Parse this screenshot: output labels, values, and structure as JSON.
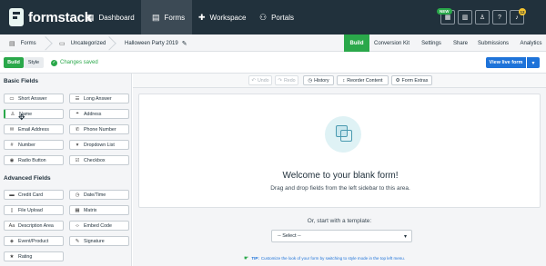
{
  "topnav": {
    "logo_text": "formstack",
    "items": [
      {
        "label": "Dashboard",
        "icon": "dashboard-icon",
        "glyph": "▦"
      },
      {
        "label": "Forms",
        "icon": "forms-icon",
        "glyph": "▤"
      },
      {
        "label": "Workspace",
        "icon": "workspace-icon",
        "glyph": "✚"
      },
      {
        "label": "Portals",
        "icon": "portals-icon",
        "glyph": "⚇"
      }
    ],
    "new_badge": "NEW",
    "notification_count": "12",
    "actions": [
      {
        "icon": "apps-grid-icon",
        "glyph": "▦"
      },
      {
        "icon": "table-icon",
        "glyph": "▥"
      },
      {
        "icon": "user-icon",
        "glyph": "♙"
      },
      {
        "icon": "help-icon",
        "glyph": "?"
      },
      {
        "icon": "bell-icon",
        "glyph": "♪"
      }
    ]
  },
  "breadcrumb": {
    "forms": "Forms",
    "folder": "Uncategorized",
    "form_name": "Halloween Party 2019"
  },
  "tabs": [
    "Build",
    "Conversion Kit",
    "Settings",
    "Share",
    "Submissions",
    "Analytics"
  ],
  "mode": {
    "build": "Build",
    "style": "Style",
    "status": "Changes saved",
    "view_live": "View live form"
  },
  "sidebar": {
    "basic_title": "Basic Fields",
    "basic_fields": [
      {
        "label": "Short Answer",
        "icon": "short-answer-icon",
        "glyph": "▭"
      },
      {
        "label": "Long Answer",
        "icon": "long-answer-icon",
        "glyph": "☰"
      },
      {
        "label": "Name",
        "icon": "name-icon",
        "glyph": "♙"
      },
      {
        "label": "Address",
        "icon": "address-icon",
        "glyph": "⌖"
      },
      {
        "label": "Email Address",
        "icon": "email-icon",
        "glyph": "✉"
      },
      {
        "label": "Phone Number",
        "icon": "phone-icon",
        "glyph": "✆"
      },
      {
        "label": "Number",
        "icon": "number-icon",
        "glyph": "#"
      },
      {
        "label": "Dropdown List",
        "icon": "dropdown-icon",
        "glyph": "▾"
      },
      {
        "label": "Radio Button",
        "icon": "radio-icon",
        "glyph": "◉"
      },
      {
        "label": "Checkbox",
        "icon": "checkbox-icon",
        "glyph": "☑"
      }
    ],
    "advanced_title": "Advanced Fields",
    "advanced_fields": [
      {
        "label": "Credit Card",
        "icon": "credit-card-icon",
        "glyph": "▬"
      },
      {
        "label": "Date/Time",
        "icon": "clock-icon",
        "glyph": "◷"
      },
      {
        "label": "File Upload",
        "icon": "file-upload-icon",
        "glyph": "▯"
      },
      {
        "label": "Matrix",
        "icon": "matrix-icon",
        "glyph": "▦"
      },
      {
        "label": "Description Area",
        "icon": "description-icon",
        "glyph": "Aa"
      },
      {
        "label": "Embed Code",
        "icon": "code-icon",
        "glyph": "‹›"
      },
      {
        "label": "Event/Product",
        "icon": "event-icon",
        "glyph": "◈"
      },
      {
        "label": "Signature",
        "icon": "signature-icon",
        "glyph": "✎"
      },
      {
        "label": "Rating",
        "icon": "rating-icon",
        "glyph": "★"
      }
    ]
  },
  "toolbar": {
    "undo": "Undo",
    "redo": "Redo",
    "history": "History",
    "reorder": "Reorder Content",
    "extras": "Form Extras"
  },
  "canvas": {
    "welcome": "Welcome to your blank form!",
    "subtitle": "Drag and drop fields from the left sidebar to this area.",
    "or_template": "Or, start with a template:",
    "select_placeholder": "-- Select --",
    "tip_label": "TIP:",
    "tip_text": "Customize the look of your form by switching to style mode in the top left menu."
  },
  "colors": {
    "nav_bg": "#21313c",
    "accent_green": "#2aa84a",
    "accent_blue": "#1e73d9"
  }
}
